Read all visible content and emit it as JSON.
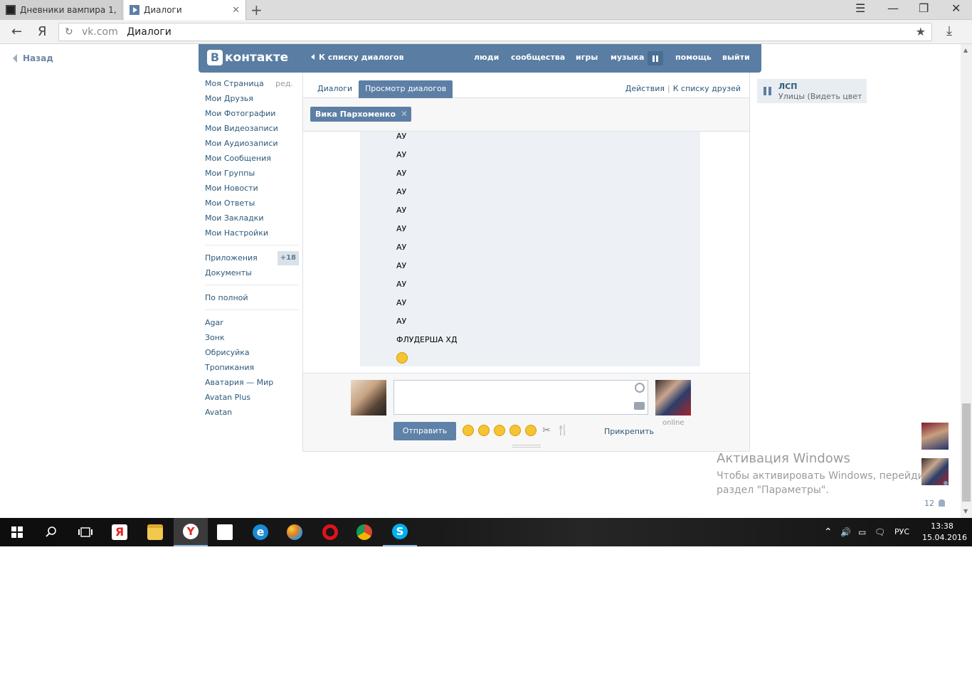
{
  "browser": {
    "tabs": [
      {
        "title": "Дневники вампира 1,"
      },
      {
        "title": "Диалоги"
      }
    ],
    "new_tab": "+",
    "window_controls": {
      "menu": "☰",
      "minimize": "—",
      "restore": "❐",
      "close": "✕"
    },
    "nav": {
      "back": "←",
      "yandex": "Я",
      "reload": "↻"
    },
    "url_domain": "vk.com",
    "url_title": "Диалоги",
    "star": "★",
    "download": "⤓"
  },
  "page": {
    "back_label": "Назад"
  },
  "header": {
    "logo_letter": "В",
    "logo_text": "контакте",
    "to_dialogs": "К списку диалогов",
    "nav": [
      "люди",
      "сообщества",
      "игры",
      "музыка",
      "помощь",
      "выйти"
    ]
  },
  "sidebar": {
    "items": [
      {
        "label": "Моя Страница",
        "extra": "ред."
      },
      {
        "label": "Мои Друзья"
      },
      {
        "label": "Мои Фотографии"
      },
      {
        "label": "Мои Видеозаписи"
      },
      {
        "label": "Мои Аудиозаписи"
      },
      {
        "label": "Мои Сообщения"
      },
      {
        "label": "Мои Группы"
      },
      {
        "label": "Мои Новости"
      },
      {
        "label": "Мои Ответы"
      },
      {
        "label": "Мои Закладки"
      },
      {
        "label": "Мои Настройки"
      }
    ],
    "apps_label": "Приложения",
    "apps_badge": "+18",
    "docs_label": "Документы",
    "full_label": "По полной",
    "games": [
      "Agar",
      "Зонк",
      "Обрисуйка",
      "Тропикания",
      "Аватария — Мир",
      "Avatan Plus",
      "Avatan"
    ]
  },
  "dialogs": {
    "tab_dialogs": "Диалоги",
    "tab_view": "Просмотр диалогов",
    "actions": "Действия",
    "to_friends": "К списку друзей",
    "filter_chip": "Вика Пархоменко",
    "messages": [
      "АУ",
      "АУ",
      "АУ",
      "АУ",
      "АУ",
      "АУ",
      "АУ",
      "АУ",
      "АУ",
      "АУ",
      "АУ",
      "ФЛУДЕРША ХД"
    ],
    "last_emoji": "😂",
    "send_label": "Отправить",
    "attach_label": "Прикрепить",
    "online_label": "online",
    "quick_emoji": [
      "😠",
      "😂",
      "😏",
      "😔",
      "😊",
      "✂",
      "🍴"
    ]
  },
  "player": {
    "artist": "ЛСП",
    "track": "Улицы (Видеть цвет..."
  },
  "activation": {
    "title": "Активация Windows",
    "line1": "Чтобы активировать Windows, перейдите в",
    "line2": "раздел \"Параметры\"."
  },
  "friends_widget": {
    "count": "12"
  },
  "taskbar": {
    "tray": {
      "chevron": "⌃",
      "volume": "🔊",
      "battery": "▭",
      "notify": "🗨",
      "lang": "РУС"
    },
    "time": "13:38",
    "date": "15.04.2016"
  }
}
